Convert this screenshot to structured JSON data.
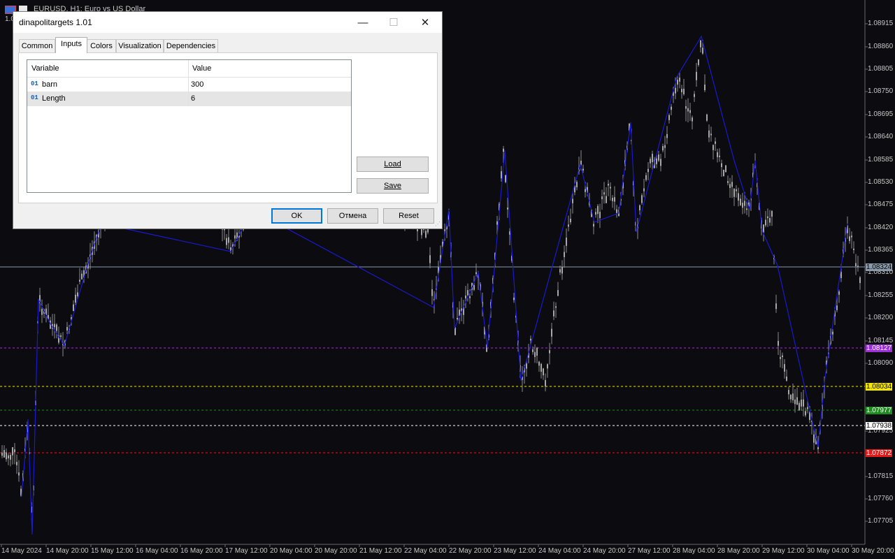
{
  "chart": {
    "title": "EURUSD, H1:  Euro vs US Dollar",
    "partial_label": "1.0",
    "price_ticks": [
      "1.08915",
      "1.08860",
      "1.08805",
      "1.08750",
      "1.08695",
      "1.08640",
      "1.08585",
      "1.08530",
      "1.08475",
      "1.08420",
      "1.08365",
      "1.08310",
      "1.08255",
      "1.08200",
      "1.08145",
      "1.08090",
      "1.07925",
      "1.07815",
      "1.07760",
      "1.07705"
    ],
    "time_ticks": [
      "14 May 2024",
      "14 May 20:00",
      "15 May 12:00",
      "16 May 04:00",
      "16 May 20:00",
      "17 May 12:00",
      "20 May 04:00",
      "20 May 20:00",
      "21 May 12:00",
      "22 May 04:00",
      "22 May 20:00",
      "23 May 12:00",
      "24 May 04:00",
      "24 May 20:00",
      "27 May 12:00",
      "28 May 04:00",
      "28 May 20:00",
      "29 May 12:00",
      "30 May 04:00",
      "30 May 20:00"
    ],
    "current_price": {
      "label": "1.08324",
      "color": "#8a9aaa"
    },
    "levels": [
      {
        "label": "1.08127",
        "color": "#9b30d9"
      },
      {
        "label": "1.08034",
        "color": "#f5e600"
      },
      {
        "label": "1.07977",
        "color": "#1f8a1f"
      },
      {
        "label": "1.07938",
        "color": "#ffffff"
      },
      {
        "label": "1.07872",
        "color": "#e01b1b"
      }
    ],
    "zigzag_color": "#1a1ad0"
  },
  "dialog": {
    "title": "dinapolitargets 1.01",
    "minimize_icon": "—",
    "maximize_icon": "☐",
    "close_icon": "✕",
    "tabs": [
      "Common",
      "Inputs",
      "Colors",
      "Visualization",
      "Dependencies"
    ],
    "active_tab": "Inputs",
    "table": {
      "columns": [
        "Variable",
        "Value"
      ],
      "rows": [
        {
          "icon": "01",
          "variable": "barn",
          "value": "300"
        },
        {
          "icon": "01",
          "variable": "Length",
          "value": "6"
        }
      ]
    },
    "load_button": "Load",
    "save_button": "Save",
    "ok_button": "OK",
    "cancel_button": "Отмена",
    "reset_button": "Reset"
  }
}
